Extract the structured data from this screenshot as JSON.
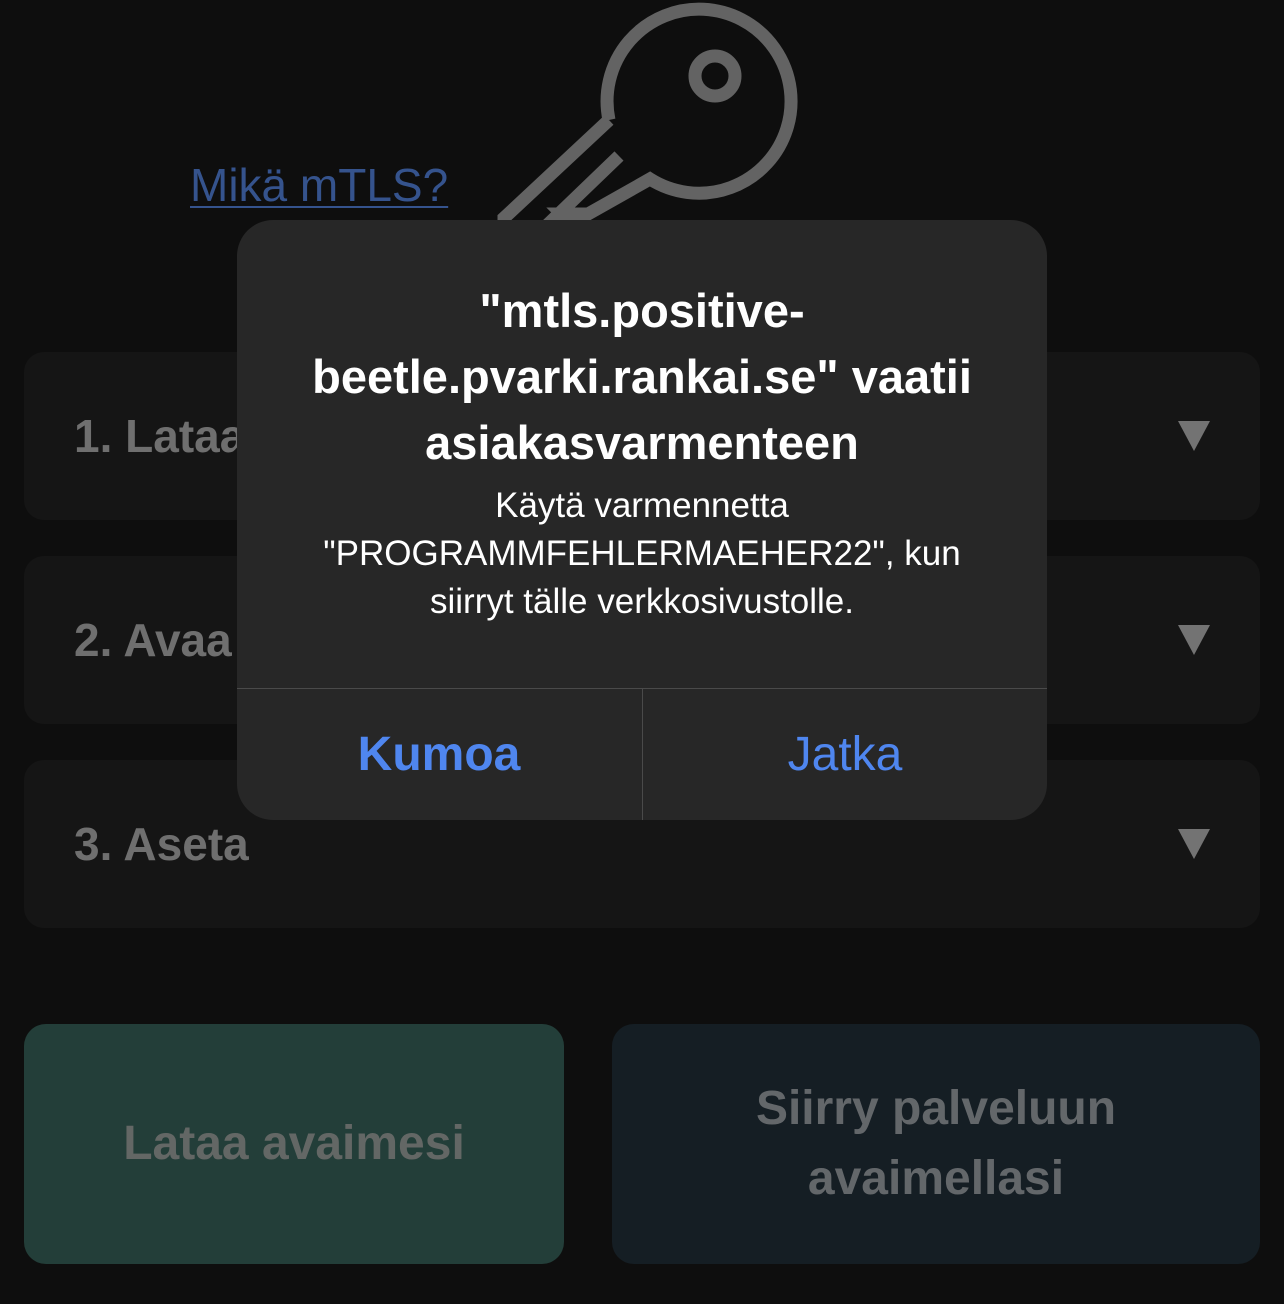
{
  "header": {
    "mtls_link": "Mikä mTLS?",
    "logo_icon": "key-icon"
  },
  "steps": [
    {
      "label": "1. Lataa",
      "icon": "triangle-down-icon"
    },
    {
      "label": "2. Avaa",
      "icon": "triangle-down-icon"
    },
    {
      "label": "3. Aseta",
      "icon": "triangle-down-icon"
    }
  ],
  "actions": {
    "download_keys": "Lataa avaimesi",
    "go_to_service_line1": "Siirry palveluun",
    "go_to_service_line2": "avaimellasi"
  },
  "alert": {
    "title_line1": "\"mtls.positive-",
    "title_line2": "beetle.pvarki.rankai.se\" vaatii",
    "title_line3": "asiakasvarmenteen",
    "message_line1": "Käytä varmennetta",
    "message_line2": "\"PROGRAMMFEHLERMAEHER22\", kun",
    "message_line3": "siirryt tälle verkkosivustolle.",
    "cancel_label": "Kumoa",
    "continue_label": "Jatka"
  },
  "colors": {
    "background": "#141414",
    "card": "#1e1e1e",
    "link": "#4a74c4",
    "alert_button": "#4f86ef",
    "download_button": "#31574f",
    "proceed_button": "#1e2a33"
  }
}
